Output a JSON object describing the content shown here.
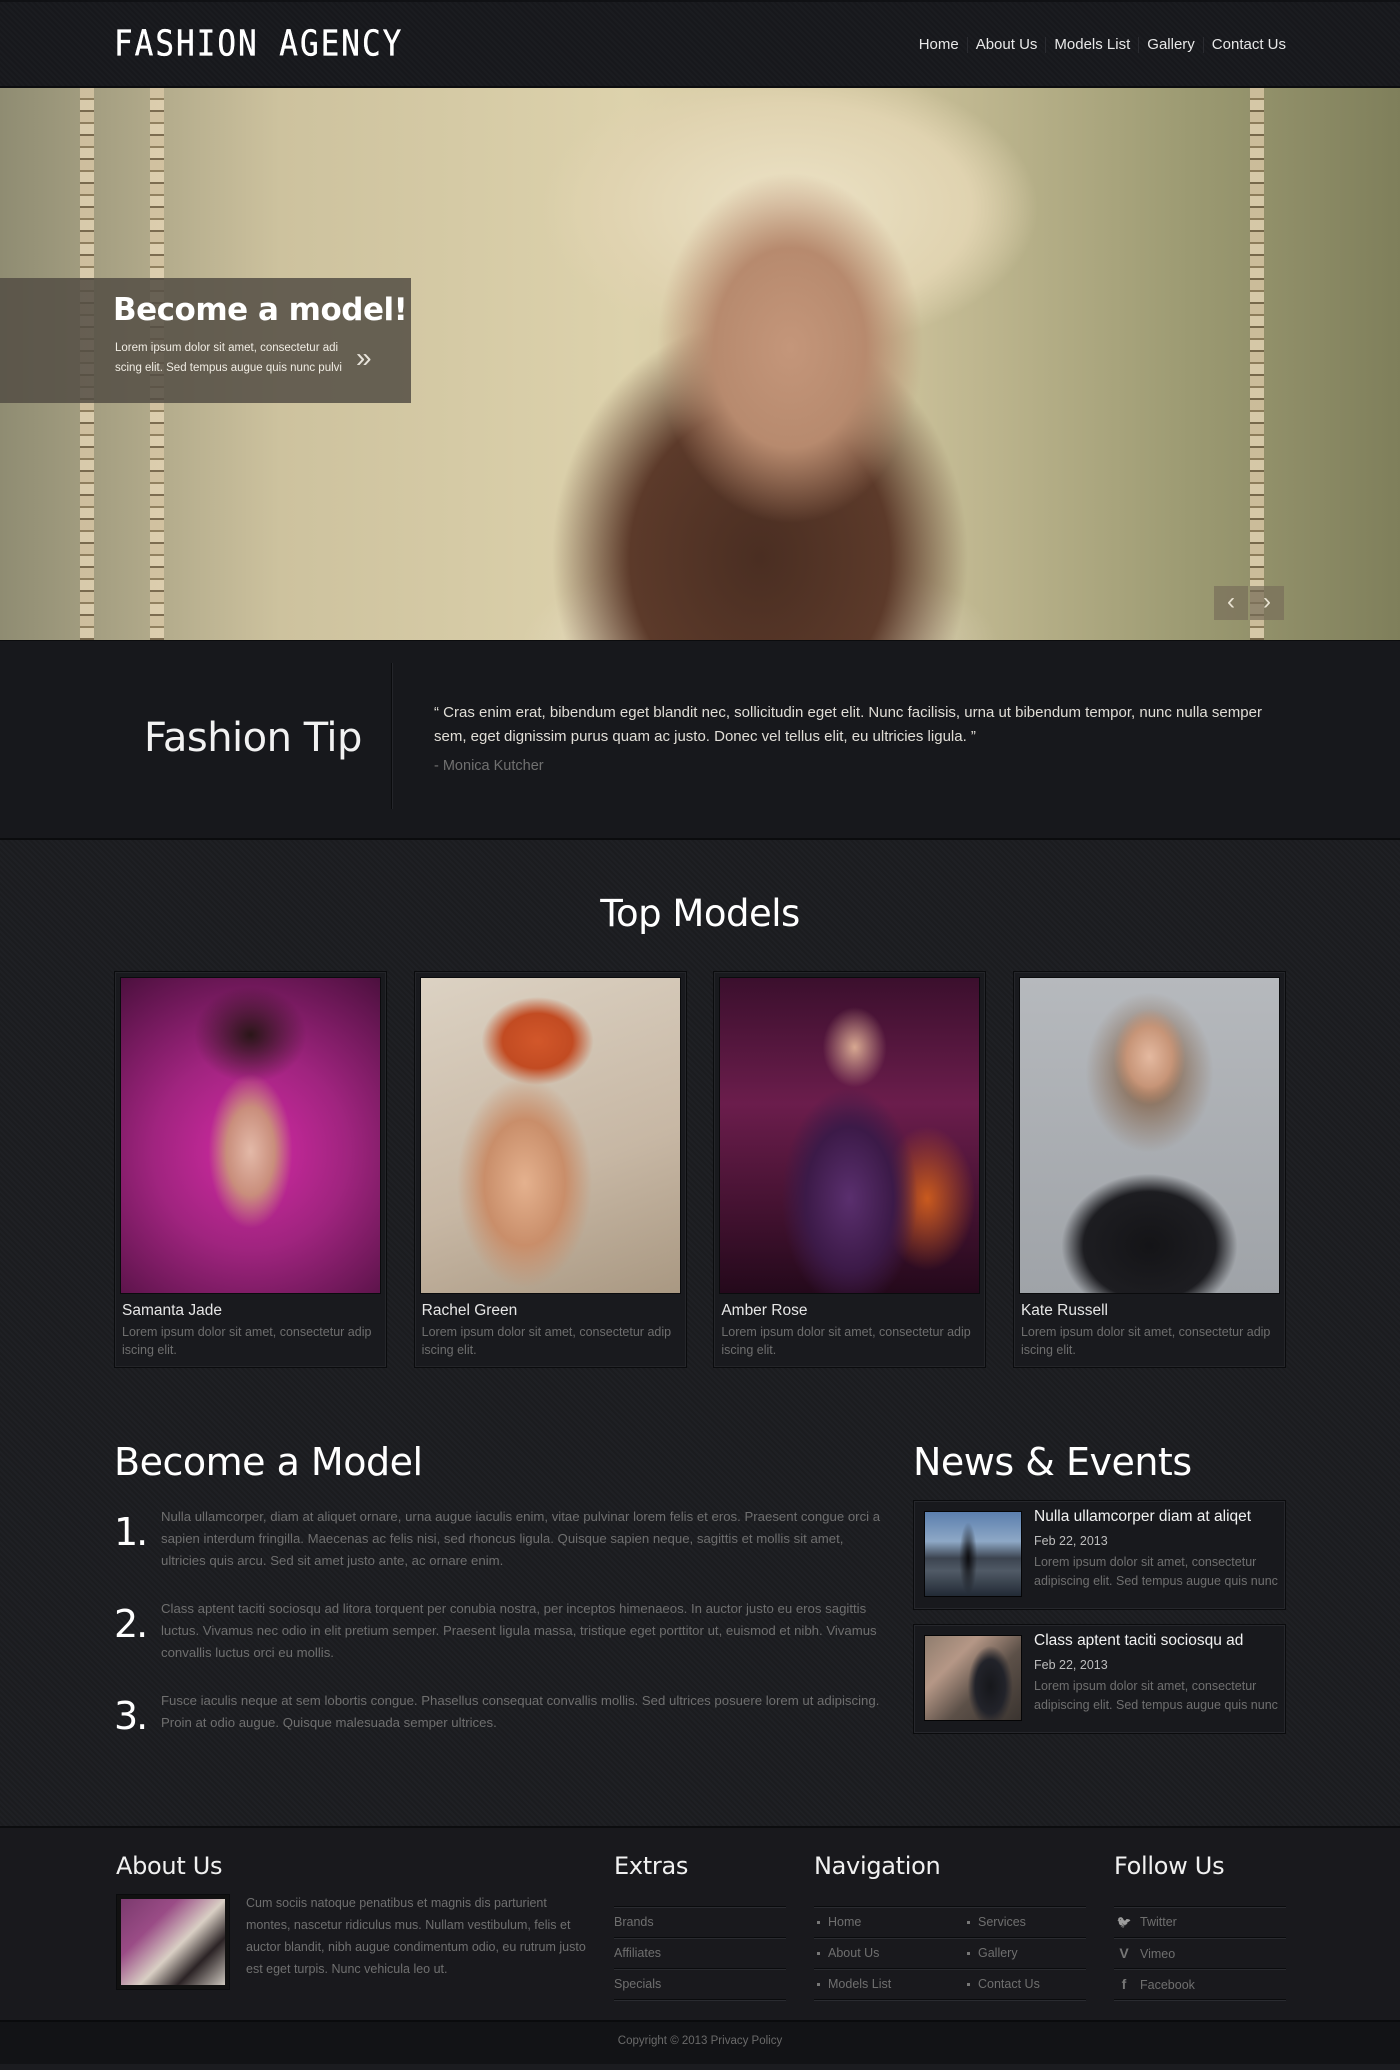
{
  "header": {
    "logo": "FASHION AGENCY",
    "nav": [
      "Home",
      "About Us",
      "Models List",
      "Gallery",
      "Contact Us"
    ]
  },
  "hero": {
    "caption_title": "Become a model!",
    "caption_text": "Lorem ipsum dolor sit amet, consectetur adi scing elit. Sed tempus augue quis nunc pulvi",
    "arrow_icon": "»",
    "prev_icon": "‹",
    "next_icon": "›"
  },
  "fashion_tip": {
    "title": "Fashion Tip",
    "quote": "“ Cras enim erat, bibendum eget blandit nec, sollicitudin eget elit. Nunc facilisis, urna ut bibendum tempor, nunc nulla semper sem, eget dignissim purus quam ac justo. Donec vel tellus elit, eu ultricies ligula. ”",
    "author": "- Monica Kutcher"
  },
  "top_models": {
    "title": "Top Models",
    "models": [
      {
        "name": "Samanta Jade",
        "desc": "Lorem ipsum dolor sit amet, consectetur adip iscing elit.",
        "bg": "#a0247f"
      },
      {
        "name": "Rachel Green",
        "desc": "Lorem ipsum dolor sit amet, consectetur adip iscing elit.",
        "bg": "#c7b7a4"
      },
      {
        "name": "Amber Rose",
        "desc": "Lorem ipsum dolor sit amet, consectetur adip iscing elit.",
        "bg": "#4a1636"
      },
      {
        "name": "Kate Russell",
        "desc": "Lorem ipsum dolor sit amet, consectetur adip iscing elit.",
        "bg": "#9fa3a8"
      }
    ]
  },
  "become_model": {
    "title": "Become a Model",
    "steps": [
      {
        "num": "1.",
        "text": "Nulla ullamcorper, diam at aliquet ornare, urna augue iaculis enim, vitae pulvinar lorem felis et eros. Praesent congue orci a sapien interdum fringilla. Maecenas ac felis nisi, sed rhoncus ligula. Quisque sapien neque, sagittis et mollis sit amet, ultricies quis arcu. Sed sit amet justo ante, ac ornare enim."
      },
      {
        "num": "2.",
        "text": "Class aptent taciti sociosqu ad litora torquent per conubia nostra, per inceptos himenaeos. In auctor justo eu eros sagittis luctus. Vivamus nec odio in elit pretium semper. Praesent ligula massa, tristique eget porttitor ut, euismod et nibh. Vivamus convallis luctus orci eu mollis."
      },
      {
        "num": "3.",
        "text": "Fusce iaculis neque at sem lobortis congue. Phasellus consequat convallis mollis. Sed ultrices posuere lorem ut adipiscing. Proin at odio augue. Quisque malesuada semper ultrices."
      }
    ]
  },
  "news": {
    "title": "News & Events",
    "items": [
      {
        "title": "Nulla ullamcorper diam at aliqet",
        "date": "Feb 22, 2013",
        "text": "Lorem ipsum dolor sit amet, consectetur adipiscing elit. Sed tempus augue quis nunc"
      },
      {
        "title": "Class aptent taciti sociosqu ad",
        "date": "Feb 22, 2013",
        "text": "Lorem ipsum dolor sit amet, consectetur adipiscing elit. Sed tempus augue quis nunc"
      }
    ]
  },
  "footer": {
    "about": {
      "title": "About Us",
      "text": "Cum sociis natoque penatibus et magnis dis parturient montes, nascetur ridiculus mus. Nullam vestibulum, felis et auctor blandit, nibh augue condimentum odio, eu rutrum justo est eget turpis. Nunc vehicula leo ut."
    },
    "extras": {
      "title": "Extras",
      "items": [
        "Brands",
        "Affiliates",
        "Specials"
      ]
    },
    "navigation": {
      "title": "Navigation",
      "col1": [
        "Home",
        "About Us",
        "Models List"
      ],
      "col2": [
        "Services",
        "Gallery",
        "Contact Us"
      ]
    },
    "follow": {
      "title": "Follow Us",
      "items": [
        {
          "label": "Twitter",
          "icon": "🐦"
        },
        {
          "label": "Vimeo",
          "icon": "V"
        },
        {
          "label": "Facebook",
          "icon": "f"
        }
      ]
    },
    "copyright": "Copyright © 2013 Privacy Policy"
  }
}
